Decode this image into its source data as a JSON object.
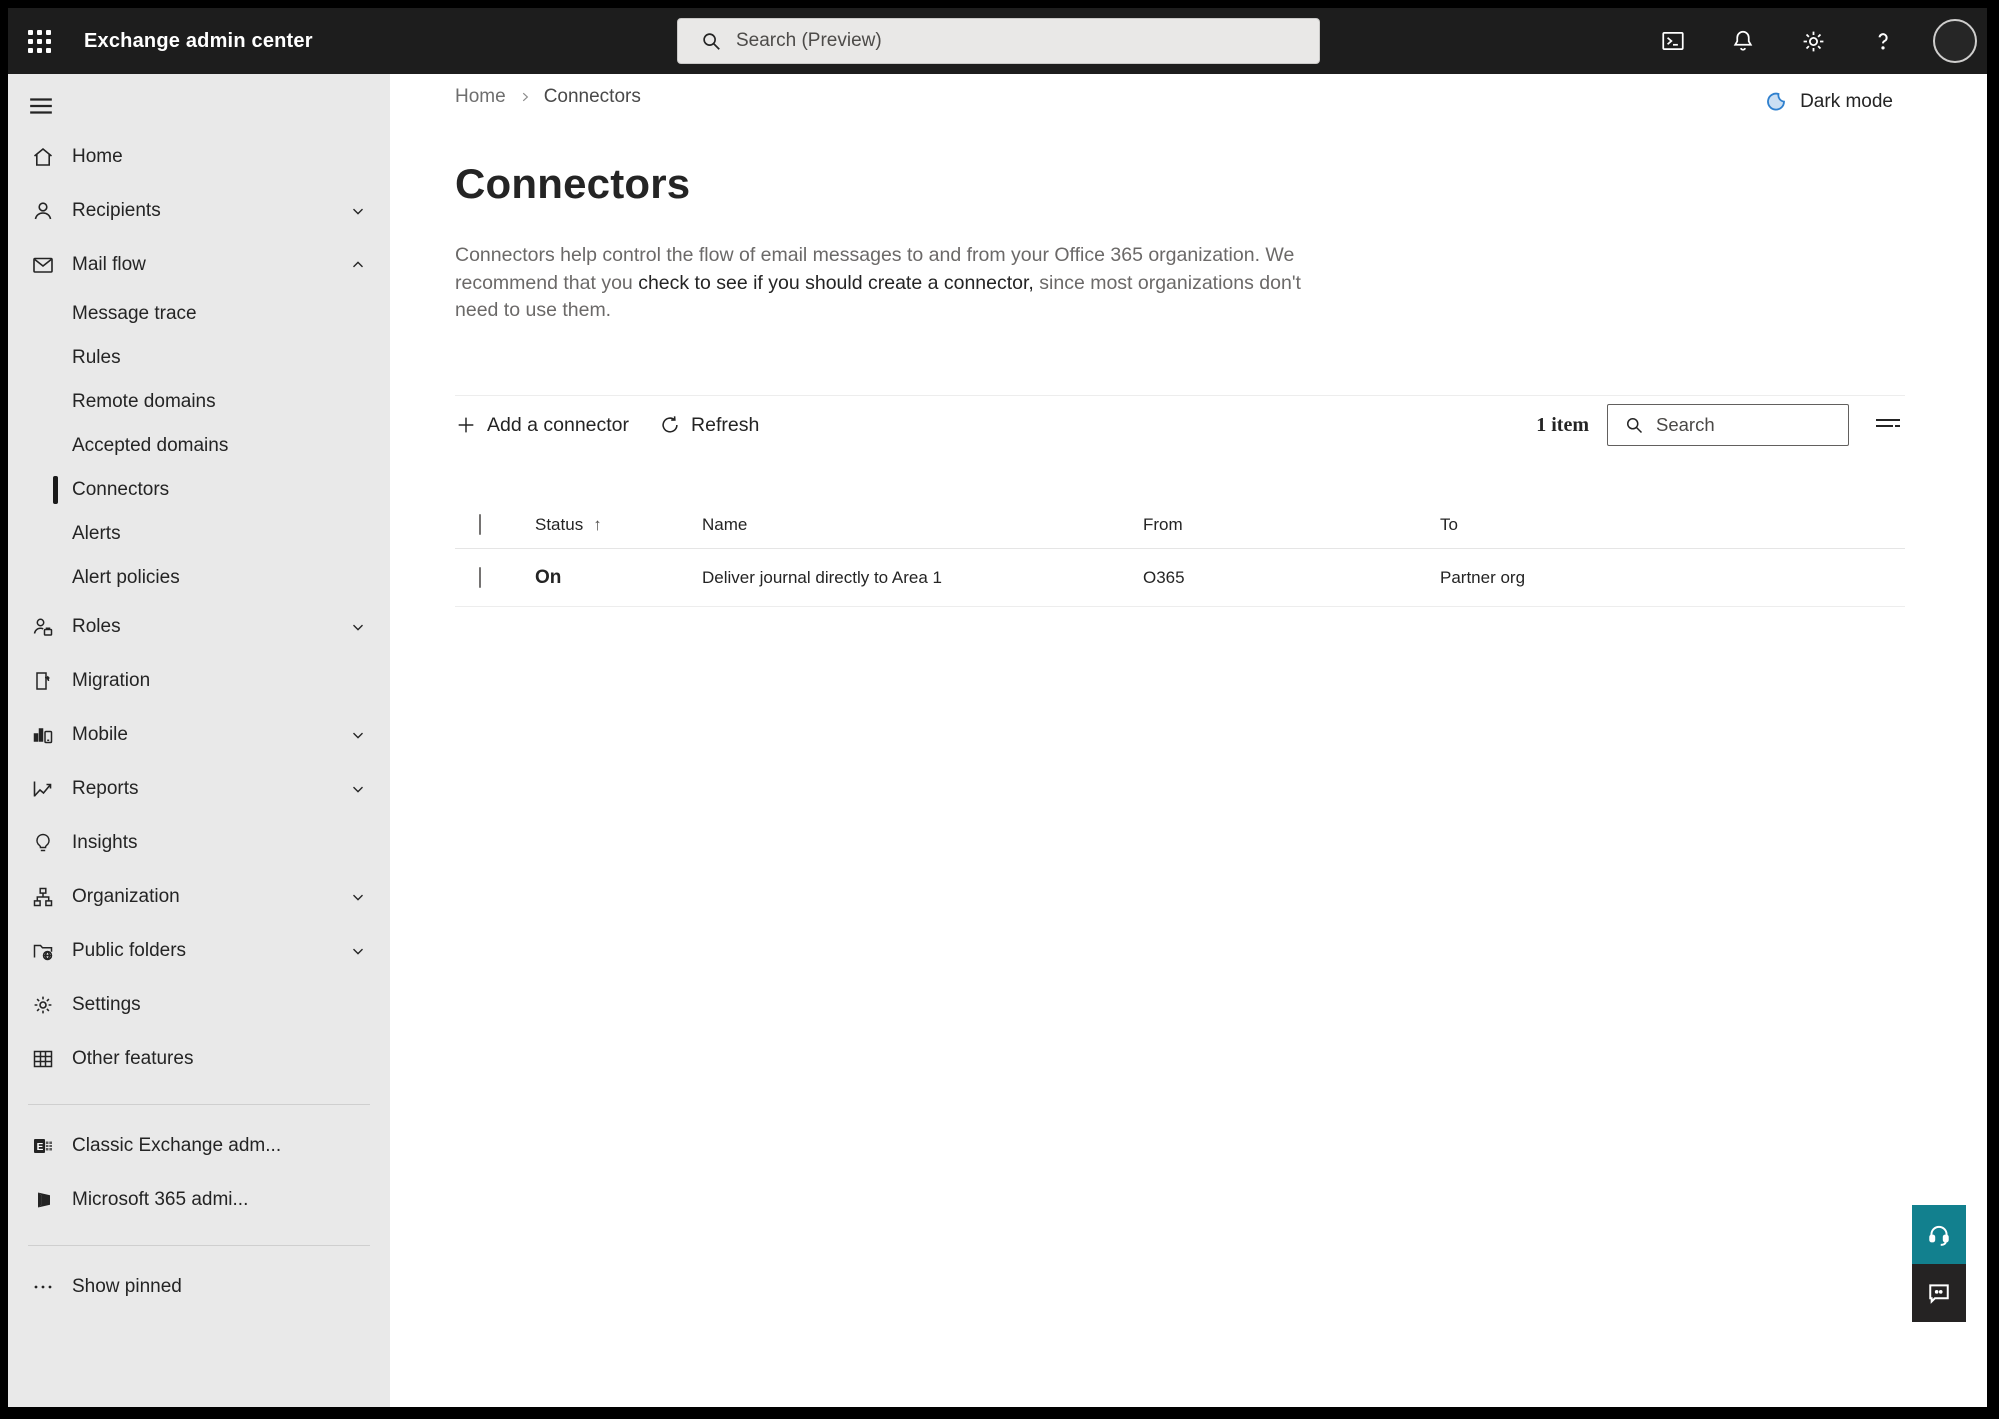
{
  "topbar": {
    "title": "Exchange admin center",
    "search_placeholder": "Search (Preview)",
    "icons": [
      "app-launcher-icon",
      "powershell-icon",
      "bell-icon",
      "gear-icon",
      "help-icon",
      "avatar"
    ]
  },
  "sidebar": {
    "items": [
      {
        "label": "Home"
      },
      {
        "label": "Recipients",
        "chevron": "down"
      },
      {
        "label": "Mail flow",
        "chevron": "up"
      },
      {
        "label": "Message trace",
        "sub": true
      },
      {
        "label": "Rules",
        "sub": true
      },
      {
        "label": "Remote domains",
        "sub": true
      },
      {
        "label": "Accepted domains",
        "sub": true
      },
      {
        "label": "Connectors",
        "sub": true,
        "selected": true
      },
      {
        "label": "Alerts",
        "sub": true
      },
      {
        "label": "Alert policies",
        "sub": true
      },
      {
        "label": "Roles",
        "chevron": "down"
      },
      {
        "label": "Migration"
      },
      {
        "label": "Mobile",
        "chevron": "down"
      },
      {
        "label": "Reports",
        "chevron": "down"
      },
      {
        "label": "Insights"
      },
      {
        "label": "Organization",
        "chevron": "down"
      },
      {
        "label": "Public folders",
        "chevron": "down"
      },
      {
        "label": "Settings"
      },
      {
        "label": "Other features"
      },
      {
        "label": "Classic Exchange adm..."
      },
      {
        "label": "Microsoft 365 admi..."
      },
      {
        "label": "Show pinned"
      }
    ]
  },
  "breadcrumb": {
    "home": "Home",
    "current": "Connectors"
  },
  "dark_mode": {
    "label": "Dark mode"
  },
  "page": {
    "title": "Connectors",
    "description_pre": "Connectors help control the flow of email messages to and from your Office 365 organization. We recommend that you ",
    "description_link": "check to see if you should create a connector,",
    "description_post": " since most organizations don't need to use them."
  },
  "toolbar": {
    "add_label": "Add a connector",
    "refresh_label": "Refresh",
    "item_count": "1 item",
    "search_placeholder": "Search"
  },
  "table": {
    "columns": [
      "Status",
      "Name",
      "From",
      "To"
    ],
    "sort_indicator": "↑",
    "rows": [
      {
        "status": "On",
        "name": "Deliver journal directly to Area 1",
        "from": "O365",
        "to": "Partner org"
      }
    ]
  },
  "colors": {
    "topbar_bg": "#1d1d1d",
    "sidebar_bg": "#e9e9e9",
    "accent_moon_blue": "#2f80ce",
    "help_teal": "#12808e",
    "feedback_dark": "#252323",
    "text_primary": "#242424",
    "text_secondary": "#6b6968"
  }
}
